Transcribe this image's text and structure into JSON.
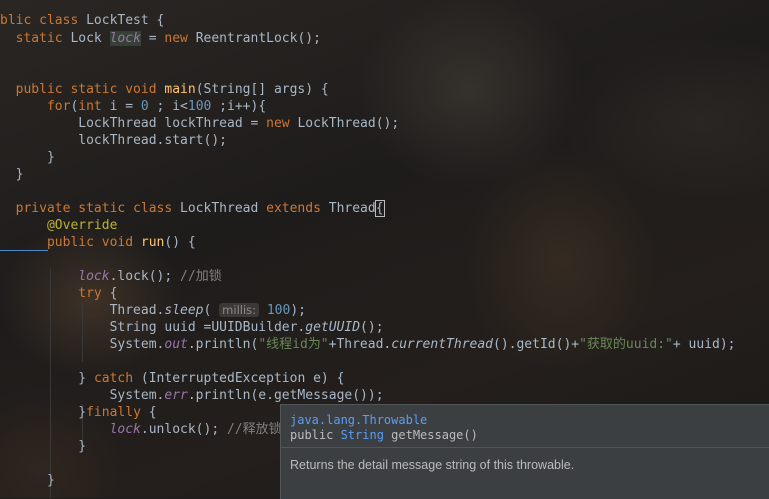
{
  "editor": {
    "lines": {
      "l1": [
        "blic class ",
        "LockTest",
        " {"
      ],
      "l2": [
        "static ",
        "Lock ",
        "lock",
        " = ",
        "new ",
        "ReentrantLock",
        "();"
      ],
      "l5": [
        "public static void ",
        "main",
        "(String[] args) {"
      ],
      "l6": [
        "for",
        "(",
        "int ",
        "i = ",
        "0",
        " ; i<",
        "100",
        " ;i++){"
      ],
      "l7": [
        "LockThread lockThread = ",
        "new ",
        "LockThread();"
      ],
      "l8": [
        "lockThread.start();"
      ],
      "l9": [
        "}"
      ],
      "l10": [
        "}"
      ],
      "l12": [
        "private static class ",
        "LockThread ",
        "extends ",
        "Thread",
        "{"
      ],
      "l13": [
        "@Override"
      ],
      "l14": [
        "public void ",
        "run",
        "() {"
      ],
      "l16": [
        "lock",
        ".lock(); ",
        "//加锁"
      ],
      "l17": [
        "try",
        " {"
      ],
      "l18": [
        "Thread.",
        "sleep",
        "( ",
        "millis:",
        " ",
        "100",
        ");"
      ],
      "l19": [
        "String uuid =UUIDBuilder.",
        "getUUID",
        "();"
      ],
      "l20": [
        "System.",
        "out",
        ".println(",
        "\"线程id为\"",
        "+Thread.",
        "currentThread",
        "().getId()+",
        "\"获取的uuid:\"",
        "+ uuid);"
      ],
      "l22": [
        "} ",
        "catch",
        " (InterruptedException e) {"
      ],
      "l23": [
        "System.",
        "err",
        ".println(e.getMessage());"
      ],
      "l24": [
        "}",
        "finally",
        " {"
      ],
      "l25": [
        "lock",
        ".unlock(); ",
        "//释放锁"
      ],
      "l26": [
        "}"
      ],
      "l28": [
        "}"
      ]
    }
  },
  "popup": {
    "package": "java.lang.Throwable",
    "signature_prefix": "public ",
    "signature_type": "String",
    "signature_rest": " getMessage()",
    "description": "Returns the detail message string of this throwable."
  }
}
